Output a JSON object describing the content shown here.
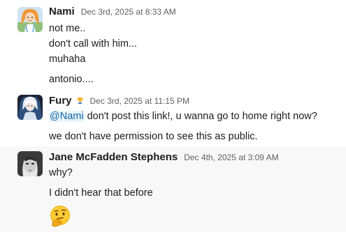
{
  "messages": [
    {
      "author": "Nami",
      "time": "Dec 3rd, 2025 at 8:33 AM",
      "avatar_icon": "nami-avatar",
      "lines": [
        "not me..",
        "don't call with him...",
        "muhaha",
        "antonio...."
      ]
    },
    {
      "author": "Fury",
      "time": "Dec 3rd, 2025 at 11:15 PM",
      "avatar_icon": "fury-avatar",
      "status_icon": "trophy-icon",
      "mention": "@Nami",
      "mention_rest": " don't post this link!, u wanna go to home right now?",
      "lines": [
        "we don't have permission to see this as public."
      ]
    },
    {
      "author": "Jane McFadden Stephens",
      "time": "Dec 4th, 2025 at 3:09 AM",
      "avatar_icon": "jane-avatar",
      "lines": [
        "why?",
        "I didn't hear that before"
      ],
      "emoji": "thinking-face-emoji"
    }
  ],
  "colors": {
    "mention_text": "#1264a3",
    "mention_bg": "#e8f5fa",
    "hover_bg": "#f8f8f8",
    "timestamp": "#616061"
  }
}
